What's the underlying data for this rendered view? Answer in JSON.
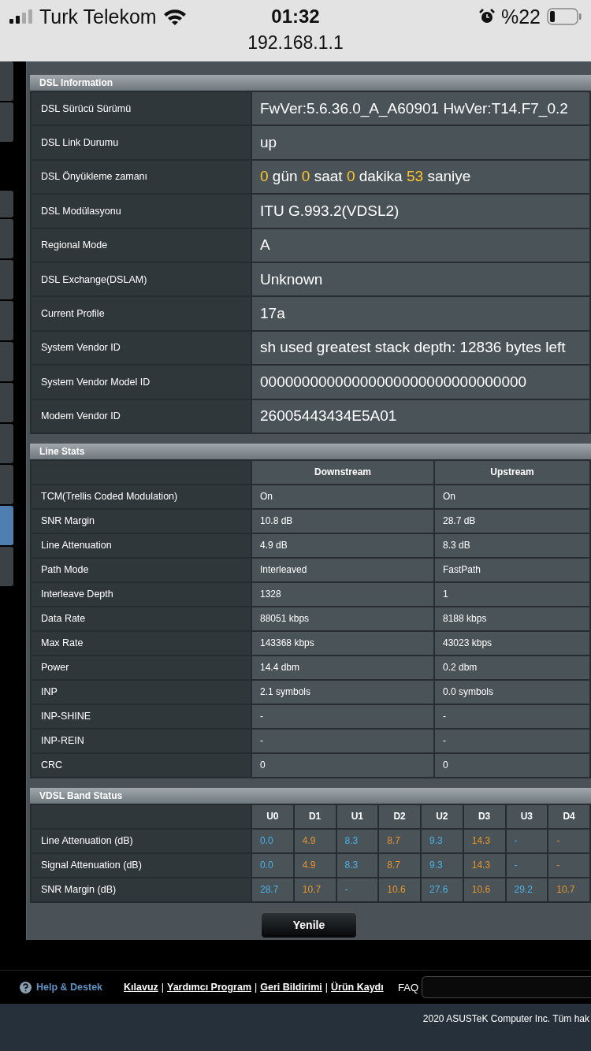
{
  "status_bar": {
    "carrier": "Turk Telekom",
    "time": "01:32",
    "battery": "%22",
    "url": "192.168.1.1"
  },
  "sidebar_tabs": [
    {
      "selected": false
    },
    {
      "selected": false
    },
    {
      "selected": false
    },
    {
      "selected": false
    },
    {
      "selected": false
    },
    {
      "selected": false
    },
    {
      "selected": false
    },
    {
      "selected": false
    },
    {
      "selected": false
    },
    {
      "selected": false
    },
    {
      "selected": true
    },
    {
      "selected": false
    }
  ],
  "dsl_information": {
    "title": "DSL Information",
    "rows": [
      {
        "label": "DSL Sürücü Sürümü",
        "value": [
          {
            "text": "FwVer:5.6.36.0_A_A60901 HwVer:T14.F7_0.2",
            "highlight": false
          }
        ]
      },
      {
        "label": "DSL Link Durumu",
        "value": [
          {
            "text": "up",
            "highlight": false
          }
        ]
      },
      {
        "label": "DSL Önyükleme zamanı",
        "value": [
          {
            "text": "0",
            "highlight": true
          },
          {
            "text": "gün",
            "highlight": false
          },
          {
            "text": "0",
            "highlight": true
          },
          {
            "text": "saat",
            "highlight": false
          },
          {
            "text": "0",
            "highlight": true
          },
          {
            "text": "dakika",
            "highlight": false
          },
          {
            "text": "53",
            "highlight": true
          },
          {
            "text": "saniye",
            "highlight": false
          }
        ]
      },
      {
        "label": "DSL Modülasyonu",
        "value": [
          {
            "text": "ITU G.993.2(VDSL2)",
            "highlight": false
          }
        ]
      },
      {
        "label": "Regional Mode",
        "value": [
          {
            "text": "A",
            "highlight": false
          }
        ]
      },
      {
        "label": "DSL Exchange(DSLAM)",
        "value": [
          {
            "text": "Unknown",
            "highlight": false
          }
        ]
      },
      {
        "label": "Current Profile",
        "value": [
          {
            "text": "17a",
            "highlight": false
          }
        ]
      },
      {
        "label": "System Vendor ID",
        "value": [
          {
            "text": "sh used greatest stack depth: 12836 bytes left",
            "highlight": false
          }
        ]
      },
      {
        "label": "System Vendor Model ID",
        "value": [
          {
            "text": "00000000000000000000000000000000",
            "highlight": false
          }
        ]
      },
      {
        "label": "Modem Vendor ID",
        "value": [
          {
            "text": "26005443434E5A01",
            "highlight": false
          }
        ]
      }
    ]
  },
  "line_stats": {
    "title": "Line Stats",
    "columns": [
      "Downstream",
      "Upstream"
    ],
    "rows": [
      {
        "label": "TCM(Trellis Coded Modulation)",
        "downstream": "On",
        "upstream": "On"
      },
      {
        "label": "SNR Margin",
        "downstream": "10.8 dB",
        "upstream": "28.7 dB"
      },
      {
        "label": "Line Attenuation",
        "downstream": "4.9 dB",
        "upstream": "8.3 dB"
      },
      {
        "label": "Path Mode",
        "downstream": "Interleaved",
        "upstream": "FastPath"
      },
      {
        "label": "Interleave Depth",
        "downstream": "1328",
        "upstream": "1"
      },
      {
        "label": "Data Rate",
        "downstream": "88051 kbps",
        "upstream": "8188 kbps"
      },
      {
        "label": "Max Rate",
        "downstream": "143368 kbps",
        "upstream": "43023 kbps"
      },
      {
        "label": "Power",
        "downstream": "14.4 dbm",
        "upstream": "0.2 dbm"
      },
      {
        "label": "INP",
        "downstream": "2.1 symbols",
        "upstream": "0.0 symbols"
      },
      {
        "label": "INP-SHINE",
        "downstream": "-",
        "upstream": "-"
      },
      {
        "label": "INP-REIN",
        "downstream": "-",
        "upstream": "-"
      },
      {
        "label": "CRC",
        "downstream": "0",
        "upstream": "0"
      }
    ]
  },
  "vdsl_band_status": {
    "title": "VDSL Band Status",
    "columns": [
      {
        "label": "U0",
        "color": "#4ab2e6"
      },
      {
        "label": "D1",
        "color": "#e8952c"
      },
      {
        "label": "U1",
        "color": "#4ab2e6"
      },
      {
        "label": "D2",
        "color": "#e8952c"
      },
      {
        "label": "U2",
        "color": "#4ab2e6"
      },
      {
        "label": "D3",
        "color": "#e8952c"
      },
      {
        "label": "U3",
        "color": "#4ab2e6"
      },
      {
        "label": "D4",
        "color": "#e8952c"
      }
    ],
    "rows": [
      {
        "label": "Line Attenuation (dB)",
        "values": [
          "0.0",
          "4.9",
          "8.3",
          "8.7",
          "9.3",
          "14.3",
          "-",
          "-"
        ]
      },
      {
        "label": "Signal Attenuation (dB)",
        "values": [
          "0.0",
          "4.9",
          "8.3",
          "8.7",
          "9.3",
          "14.3",
          "-",
          "-"
        ]
      },
      {
        "label": "SNR Margin (dB)",
        "values": [
          "28.7",
          "10.7",
          "-",
          "10.6",
          "27.6",
          "10.6",
          "29.2",
          "10.7"
        ]
      }
    ]
  },
  "refresh_button": "Yenile",
  "footer": {
    "help": "Help & Destek",
    "links": [
      "Kılavuz",
      "Yardımcı Program",
      "Geri Bildirimi",
      "Ürün Kaydı"
    ],
    "separator": "|",
    "faq": "FAQ",
    "copyright": "2020 ASUSTeK Computer Inc. Tüm hak"
  }
}
